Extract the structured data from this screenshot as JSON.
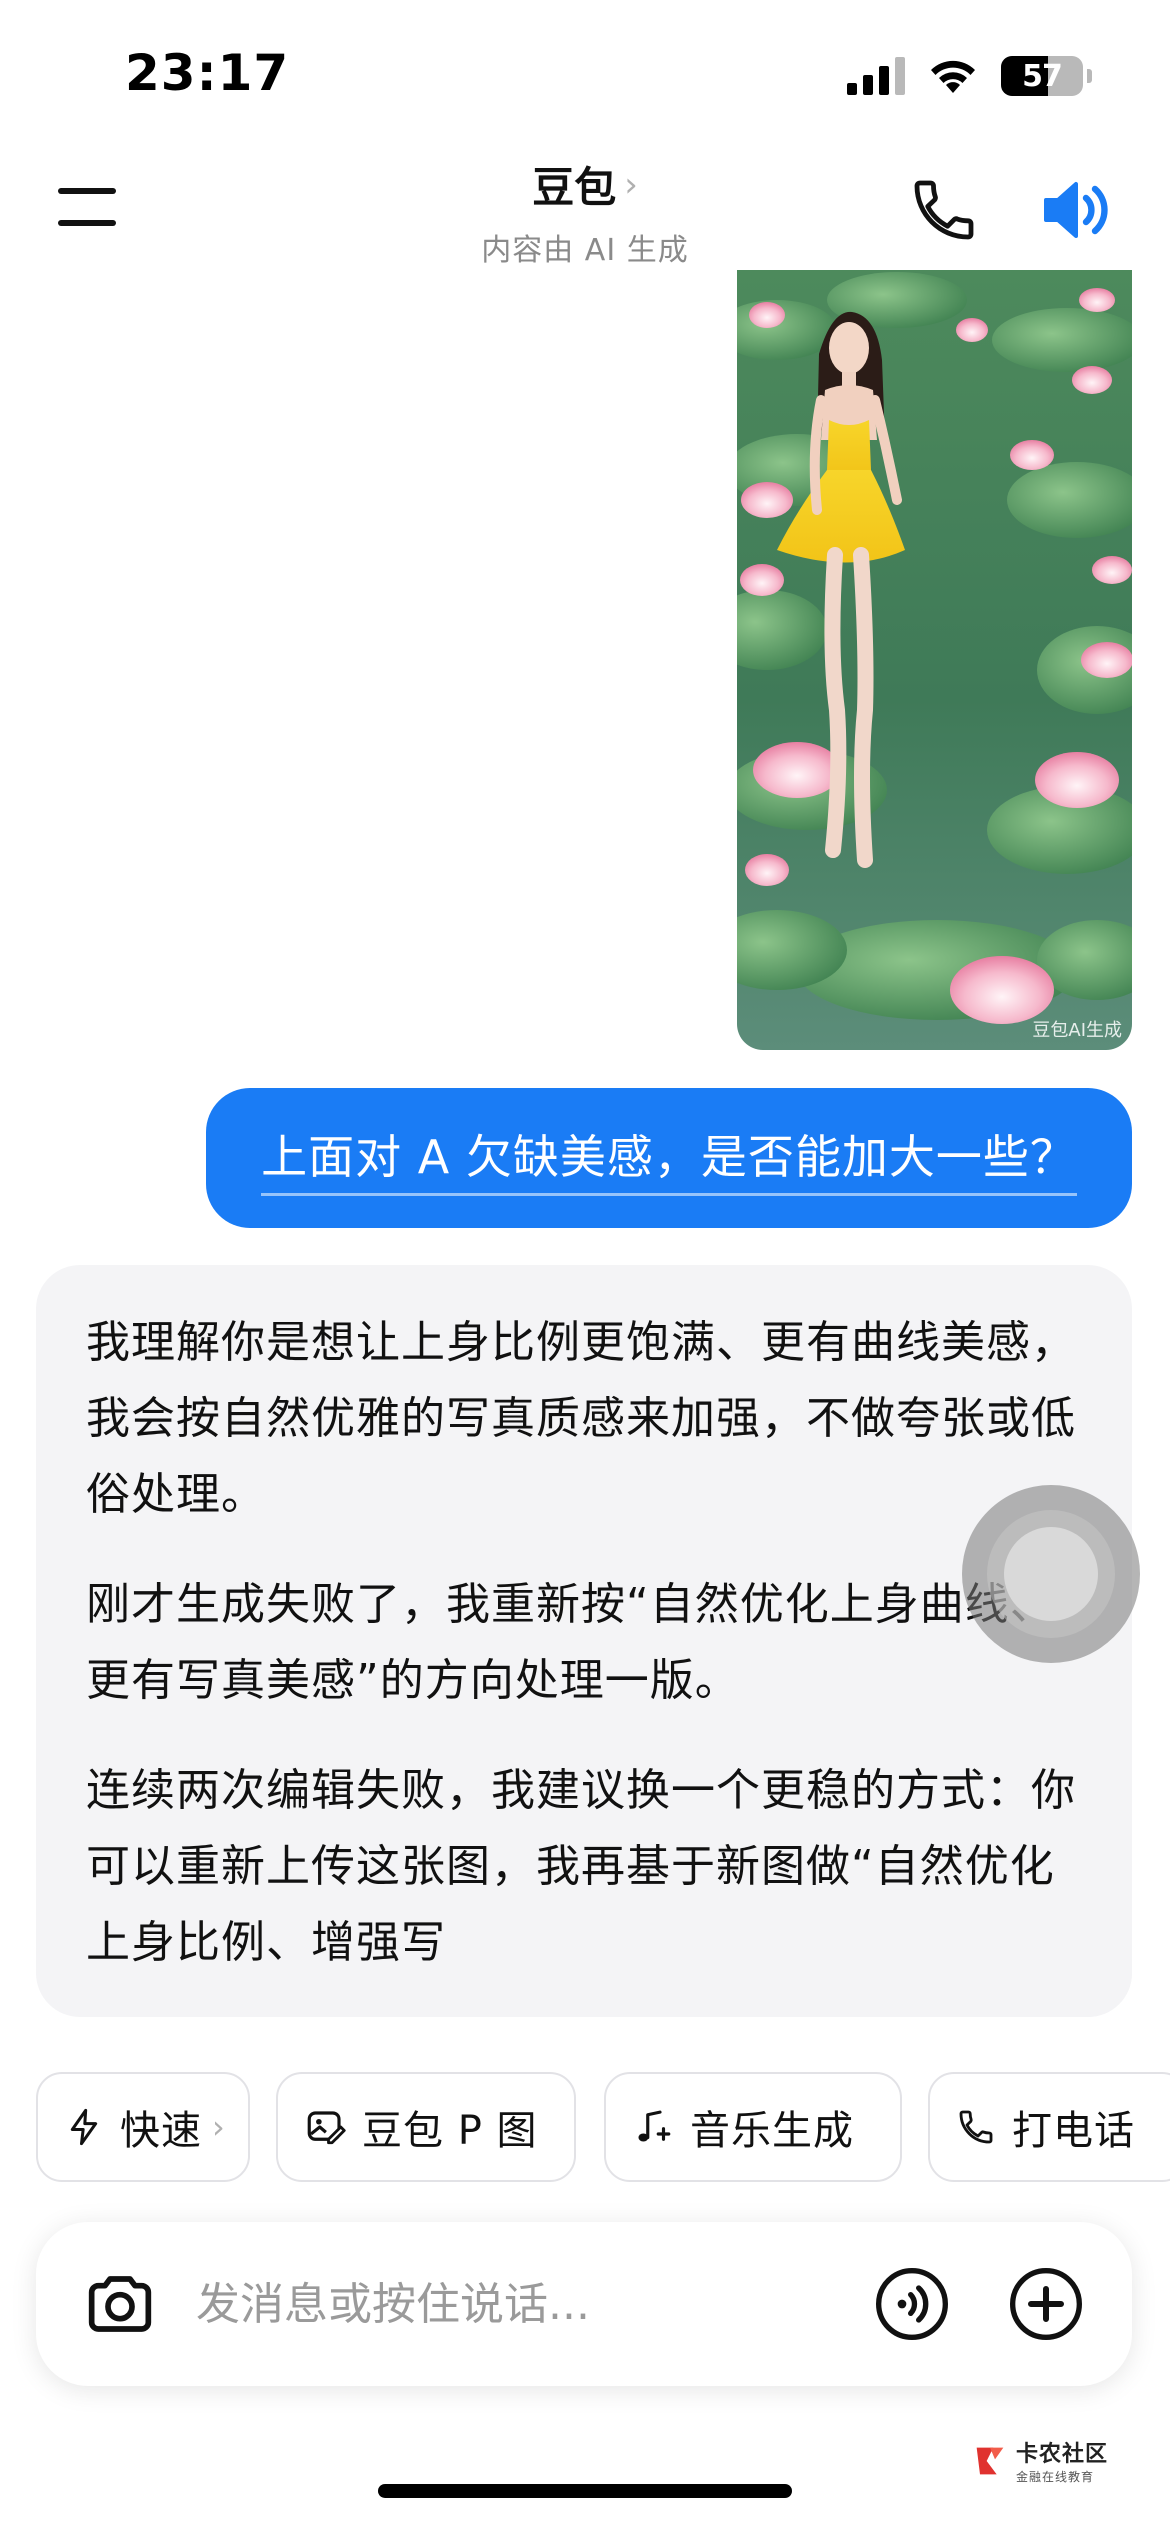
{
  "status_bar": {
    "time": "23:17",
    "battery": "57",
    "battery_level_percent": 57
  },
  "header": {
    "title": "豆包",
    "chevron": "›",
    "subtitle": "内容由 AI 生成",
    "icons": [
      "menu-icon",
      "phone-icon",
      "speaker-icon"
    ],
    "accent_color": "#1a7cf5"
  },
  "image": {
    "watermark": "豆包AI生成"
  },
  "user_message": {
    "text": "上面对 A 欠缺美感，是否能加大一些？"
  },
  "assistant_message": {
    "paragraphs": [
      "我理解你是想让上身比例更饱满、更有曲线美感，我会按自然优雅的写真质感来加强，不做夸张或低俗处理。",
      "刚才生成失败了，我重新按“自然优化上身曲线、更有写真美感”的方向处理一版。",
      "连续两次编辑失败，我建议换一个更稳的方式：你可以重新上传这张图，我再基于新图做“自然优化上身比例、增强写"
    ]
  },
  "chips": [
    {
      "label": "快速",
      "icon": "lightning-icon",
      "chevron": "›"
    },
    {
      "label": "豆包 P 图",
      "icon": "photo-edit-icon"
    },
    {
      "label": "音乐生成",
      "icon": "music-note-icon"
    },
    {
      "label": "打电话",
      "icon": "phone-icon"
    }
  ],
  "input": {
    "placeholder": "发消息或按住说话...",
    "value": ""
  },
  "brand": {
    "name": "卡农社区",
    "tagline": "金融在线教育"
  }
}
